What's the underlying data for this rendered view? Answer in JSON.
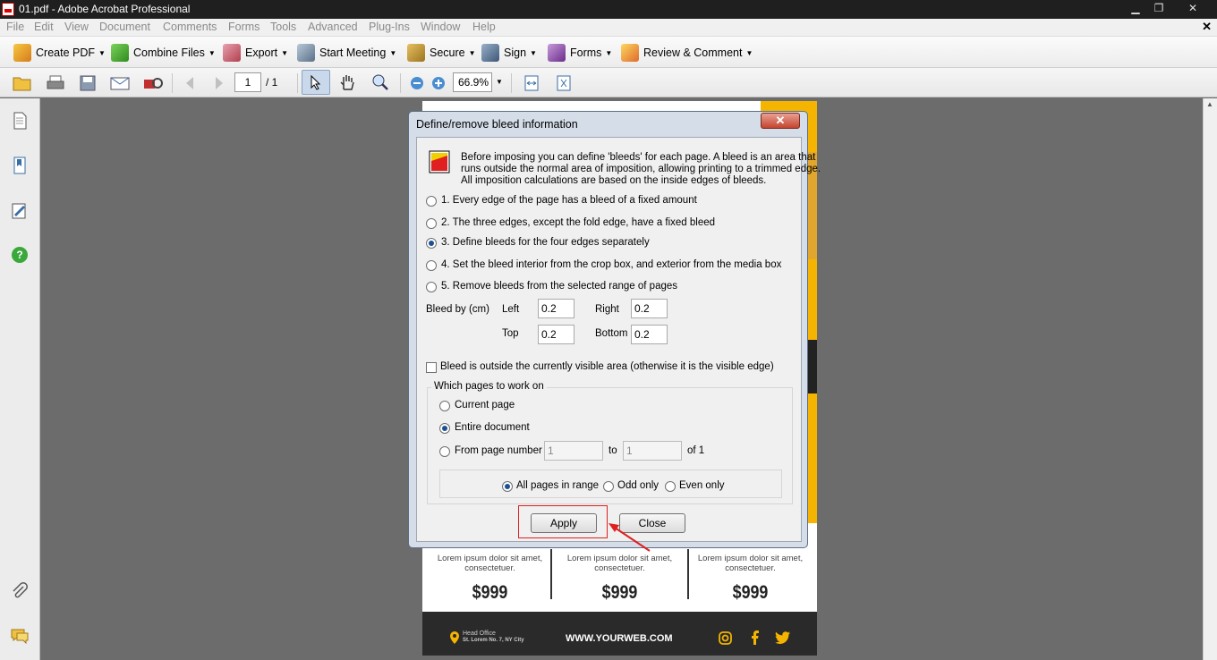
{
  "window": {
    "title": "01.pdf - Adobe Acrobat Professional",
    "minimize": "▁",
    "restore": "❐",
    "close": "✕"
  },
  "menubar": {
    "items": [
      "File",
      "Edit",
      "View",
      "Document",
      "Comments",
      "Forms",
      "Tools",
      "Advanced",
      "Plug-Ins",
      "Window",
      "Help"
    ],
    "close": "✕"
  },
  "toolbar1": {
    "create_pdf": "Create PDF",
    "combine_files": "Combine Files",
    "export": "Export",
    "start_meeting": "Start Meeting",
    "secure": "Secure",
    "sign": "Sign",
    "forms": "Forms",
    "review_comment": "Review & Comment"
  },
  "toolbar2": {
    "page_number": "1",
    "page_total": "/ 1",
    "zoom": "66.9%"
  },
  "document": {
    "lorem": "Lorem ipsum dolor sit amet, consectetuer.",
    "prices": [
      "$999",
      "$999",
      "$999"
    ],
    "head_office": "Head Office",
    "address": "St. Lorem No. 7, NY City",
    "website": "WWW.YOURWEB.COM"
  },
  "dialog": {
    "title": "Define/remove bleed information",
    "close": "✕",
    "intro_1": "Before imposing you can define 'bleeds' for each page. A bleed is an area that",
    "intro_2": "runs outside the normal area of imposition, allowing printing to a trimmed edge.",
    "intro_3": "All imposition calculations are based on the inside edges of bleeds.",
    "options": [
      "1. Every edge of the page has a bleed of a fixed amount",
      "2. The three edges, except the fold edge, have a fixed bleed",
      "3. Define bleeds for the four edges separately",
      "4. Set the bleed interior from the crop box, and exterior from the media box",
      "5. Remove bleeds from the selected range of pages"
    ],
    "selected_option": 3,
    "bleed_by_label": "Bleed by (cm)",
    "left_label": "Left",
    "left_value": "0.2",
    "right_label": "Right",
    "right_value": "0.2",
    "top_label": "Top",
    "top_value": "0.2",
    "bottom_label": "Bottom",
    "bottom_value": "0.2",
    "outside_checkbox": "Bleed is outside the currently visible area (otherwise it is the visible edge)",
    "outside_checked": false,
    "pages_group_label": "Which pages to work on",
    "current_page": "Current page",
    "entire_document": "Entire document",
    "from_page_number": "From page number",
    "from_value": "1",
    "to_label": "to",
    "to_value": "1",
    "of_label": "of 1",
    "pages_selected": "Entire document",
    "all_pages": "All pages in range",
    "odd_only": "Odd only",
    "even_only": "Even only",
    "range_selected": "All pages in range",
    "apply": "Apply",
    "close_button": "Close"
  },
  "colors": {
    "accent_yellow": "#f4b400",
    "highlight_red": "#e02020",
    "footer_dark": "#2a2a2a"
  }
}
